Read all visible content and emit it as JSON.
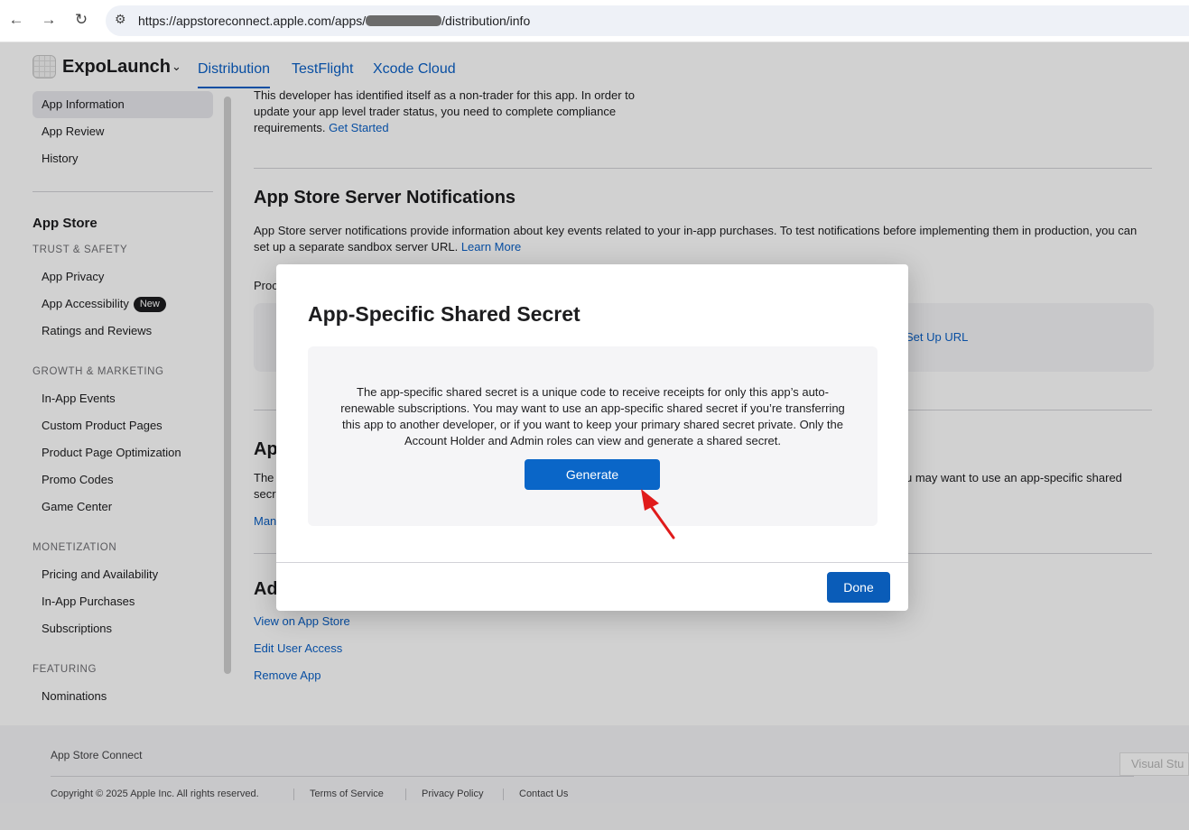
{
  "browser": {
    "url_prefix": "https://appstoreconnect.apple.com/apps/",
    "url_suffix": "/distribution/info",
    "icons": [
      "back-arrow-icon",
      "forward-arrow-icon",
      "reload-icon",
      "site-settings-icon"
    ]
  },
  "header": {
    "app_name": "ExpoLaunch",
    "tabs": [
      {
        "label": "Distribution",
        "active": true
      },
      {
        "label": "TestFlight",
        "active": false
      },
      {
        "label": "Xcode Cloud",
        "active": false
      }
    ]
  },
  "sidebar": {
    "top_items": [
      "App Information",
      "App Review",
      "History"
    ],
    "selected": "App Information",
    "app_store_heading": "App Store",
    "groups": [
      {
        "title": "TRUST & SAFETY",
        "items": [
          "App Privacy",
          "App Accessibility",
          "Ratings and Reviews"
        ],
        "badge": {
          "item": "App Accessibility",
          "label": "New"
        }
      },
      {
        "title": "GROWTH & MARKETING",
        "items": [
          "In-App Events",
          "Custom Product Pages",
          "Product Page Optimization",
          "Promo Codes",
          "Game Center"
        ]
      },
      {
        "title": "MONETIZATION",
        "items": [
          "Pricing and Availability",
          "In-App Purchases",
          "Subscriptions"
        ]
      },
      {
        "title": "FEATURING",
        "items": [
          "Nominations"
        ]
      }
    ]
  },
  "main": {
    "trader_text": "This developer has identified itself as a non-trader for this app. In order to update your app level trader status, you need to complete compliance requirements.",
    "trader_link": "Get Started",
    "notifications_title": "App Store Server Notifications",
    "notifications_text": "App Store server notifications provide information about key events related to your in-app purchases. To test notifications before implementing them in production, you can set up a separate sandbox server URL.",
    "notifications_link": "Learn More",
    "production_label_fragment": "Proc",
    "setup_url_fragment": "Set Up URL",
    "secret_title_fragment": "Ap",
    "secret_text_left": "The",
    "secret_text_left2": "secr",
    "secret_text_right": "u may want to use an app-specific shared",
    "manage_fragment": "Man",
    "additional_fragment": "Ad",
    "links": [
      "View on App Store",
      "Edit User Access",
      "Remove App"
    ]
  },
  "modal": {
    "title": "App-Specific Shared Secret",
    "description": "The app-specific shared secret is a unique code to receive receipts for only this app’s auto-renewable subscriptions. You may want to use an app-specific shared secret if you’re transferring this app to another developer, or if you want to keep your primary shared secret private. Only the Account Holder and Admin roles can view and generate a shared secret.",
    "generate_label": "Generate",
    "done_label": "Done",
    "annotation": "red-pointer-arrow"
  },
  "footer": {
    "brand": "App Store Connect",
    "copyright": "Copyright © 2025 Apple Inc. All rights reserved.",
    "links": [
      "Terms of Service",
      "Privacy Policy",
      "Contact Us"
    ],
    "overlay_chip": "Visual Stu"
  },
  "colors": {
    "accent": "#0a60c6",
    "button": "#0a66c8",
    "annotation_red": "#e01b1b"
  }
}
